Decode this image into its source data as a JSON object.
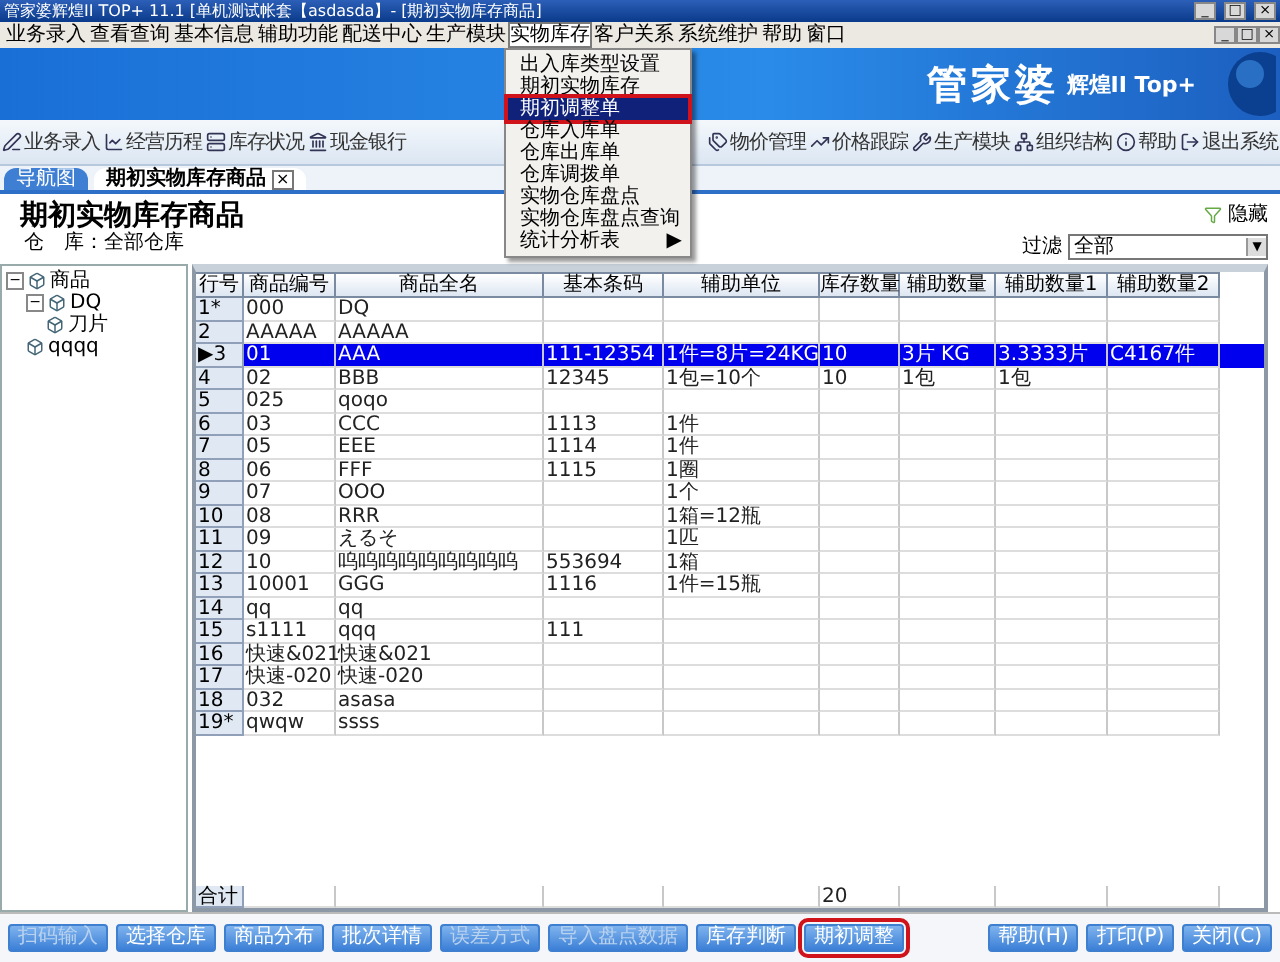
{
  "window": {
    "title": "管家婆辉煌II TOP+ 11.1 [单机测试帐套【asdasda】- [期初实物库存商品]",
    "controls": [
      "_",
      "□",
      "×"
    ]
  },
  "menu_bar": {
    "items": [
      {
        "label": "业务录入",
        "open": false
      },
      {
        "label": "查看查询",
        "open": false
      },
      {
        "label": "基本信息",
        "open": false
      },
      {
        "label": "辅助功能",
        "open": false
      },
      {
        "label": "配送中心",
        "open": false
      },
      {
        "label": "生产模块",
        "open": false
      },
      {
        "label": "实物库存",
        "open": true
      },
      {
        "label": "客户关系",
        "open": false
      },
      {
        "label": "系统维护",
        "open": false
      },
      {
        "label": "帮助",
        "open": false
      },
      {
        "label": "窗口",
        "open": false
      }
    ],
    "controls": [
      "_",
      "□",
      "×"
    ]
  },
  "dropdown": {
    "items": [
      {
        "label": "出入库类型设置",
        "selected": false,
        "highlighted": false
      },
      {
        "label": "期初实物库存",
        "selected": false,
        "highlighted": false
      },
      {
        "label": "期初调整单",
        "selected": true,
        "highlighted": true
      },
      {
        "label": "仓库入库单",
        "selected": false,
        "highlighted": false
      },
      {
        "label": "仓库出库单",
        "selected": false,
        "highlighted": false
      },
      {
        "label": "仓库调拨单",
        "selected": false,
        "highlighted": false
      },
      {
        "label": "实物仓库盘点",
        "selected": false,
        "highlighted": false
      },
      {
        "label": "实物仓库盘点查询",
        "selected": false,
        "highlighted": false
      },
      {
        "label": "统计分析表",
        "selected": false,
        "highlighted": false,
        "arrow": "▶"
      }
    ]
  },
  "banner": {
    "logo": "管家婆",
    "edition": "辉煌II Top+"
  },
  "toolbar": {
    "left": [
      "业务录入",
      "经营历程",
      "库存状况",
      "现金银行"
    ],
    "right": [
      "物价管理",
      "价格跟踪",
      "生产模块",
      "组织结构",
      "帮助",
      "退出系统"
    ]
  },
  "tabs": [
    {
      "label": "导航图",
      "selected": false
    },
    {
      "label": "期初实物库存商品",
      "selected": true,
      "close": "×"
    }
  ],
  "page": {
    "title": "期初实物库存商品",
    "warehouse_label": "仓　库：",
    "warehouse": "全部仓库",
    "hide_label": "隐藏",
    "filter_label": "过滤",
    "filter_value": "全部",
    "filter_caret": "▼"
  },
  "tree": [
    {
      "label": "商品",
      "expanded": true,
      "toggle": "−",
      "children": [
        {
          "label": "DQ",
          "expanded": true,
          "toggle": "−",
          "children": [
            {
              "label": "刀片"
            }
          ]
        },
        {
          "label": "qqqq"
        }
      ]
    }
  ],
  "table": {
    "columns": [
      "行号",
      "商品编号",
      "商品全名",
      "基本条码",
      "辅助单位",
      "库存数量",
      "辅助数量",
      "辅助数量1",
      "辅助数量2"
    ],
    "rows": [
      {
        "cells": [
          "1*",
          "000",
          "DQ",
          "",
          "",
          "",
          "",
          "",
          ""
        ],
        "selected": false
      },
      {
        "cells": [
          "2",
          "AAAAA",
          "AAAAA",
          "",
          "",
          "",
          "",
          "",
          ""
        ],
        "selected": false
      },
      {
        "cells": [
          "3",
          "01",
          "AAA",
          "111-12354",
          "1件=8片=24KG",
          "10",
          "3片 KG",
          "3.3333片",
          "C4167件"
        ],
        "selected": true
      },
      {
        "cells": [
          "4",
          "02",
          "BBB",
          "12345",
          "1包=10个",
          "10",
          "1包",
          "1包",
          ""
        ],
        "selected": false
      },
      {
        "cells": [
          "5",
          "025",
          "qoqo",
          "",
          "",
          "",
          "",
          "",
          ""
        ],
        "selected": false
      },
      {
        "cells": [
          "6",
          "03",
          "CCC",
          "1113",
          "1件",
          "",
          "",
          "",
          ""
        ],
        "selected": false
      },
      {
        "cells": [
          "7",
          "05",
          "EEE",
          "1114",
          "1件",
          "",
          "",
          "",
          ""
        ],
        "selected": false
      },
      {
        "cells": [
          "8",
          "06",
          "FFF",
          "1115",
          "1圈",
          "",
          "",
          "",
          ""
        ],
        "selected": false
      },
      {
        "cells": [
          "9",
          "07",
          "OOO",
          "",
          "1个",
          "",
          "",
          "",
          ""
        ],
        "selected": false
      },
      {
        "cells": [
          "10",
          "08",
          "RRR",
          "",
          "1箱=12瓶",
          "",
          "",
          "",
          ""
        ],
        "selected": false
      },
      {
        "cells": [
          "11",
          "09",
          "えるそ",
          "",
          "1匹",
          "",
          "",
          "",
          ""
        ],
        "selected": false
      },
      {
        "cells": [
          "12",
          "10",
          "呜呜呜呜呜呜呜呜呜",
          "553694",
          "1箱",
          "",
          "",
          "",
          ""
        ],
        "selected": false
      },
      {
        "cells": [
          "13",
          "10001",
          "GGG",
          "1116",
          "1件=15瓶",
          "",
          "",
          "",
          ""
        ],
        "selected": false
      },
      {
        "cells": [
          "14",
          "qq",
          "qq",
          "",
          "",
          "",
          "",
          "",
          ""
        ],
        "selected": false
      },
      {
        "cells": [
          "15",
          "s1111",
          "qqq",
          "111",
          "",
          "",
          "",
          "",
          ""
        ],
        "selected": false
      },
      {
        "cells": [
          "16",
          "快速&021",
          "快速&021",
          "",
          "",
          "",
          "",
          "",
          ""
        ],
        "selected": false
      },
      {
        "cells": [
          "17",
          "快速-020",
          "快速-020",
          "",
          "",
          "",
          "",
          "",
          ""
        ],
        "selected": false
      },
      {
        "cells": [
          "18",
          "032",
          "asasa",
          "",
          "",
          "",
          "",
          "",
          ""
        ],
        "selected": false
      },
      {
        "cells": [
          "19*",
          "qwqw",
          "ssss",
          "",
          "",
          "",
          "",
          "",
          ""
        ],
        "selected": false
      }
    ],
    "total_row": {
      "label": "合计",
      "quantity": "20"
    }
  },
  "buttons_left": [
    {
      "label": "扫码输入",
      "disabled": true,
      "highlighted": false
    },
    {
      "label": "选择仓库",
      "disabled": false,
      "highlighted": false
    },
    {
      "label": "商品分布",
      "disabled": false,
      "highlighted": false
    },
    {
      "label": "批次详情",
      "disabled": false,
      "highlighted": false
    },
    {
      "label": "误差方式",
      "disabled": true,
      "highlighted": false
    },
    {
      "label": "导入盘点数据",
      "disabled": true,
      "highlighted": false
    },
    {
      "label": "库存判断",
      "disabled": false,
      "highlighted": false
    },
    {
      "label": "期初调整",
      "disabled": false,
      "highlighted": true
    }
  ],
  "buttons_right": [
    {
      "label": "帮助(H)",
      "disabled": false,
      "highlighted": false
    },
    {
      "label": "打印(P)",
      "disabled": false,
      "highlighted": false
    },
    {
      "label": "关闭(C)",
      "disabled": false,
      "highlighted": false
    }
  ]
}
